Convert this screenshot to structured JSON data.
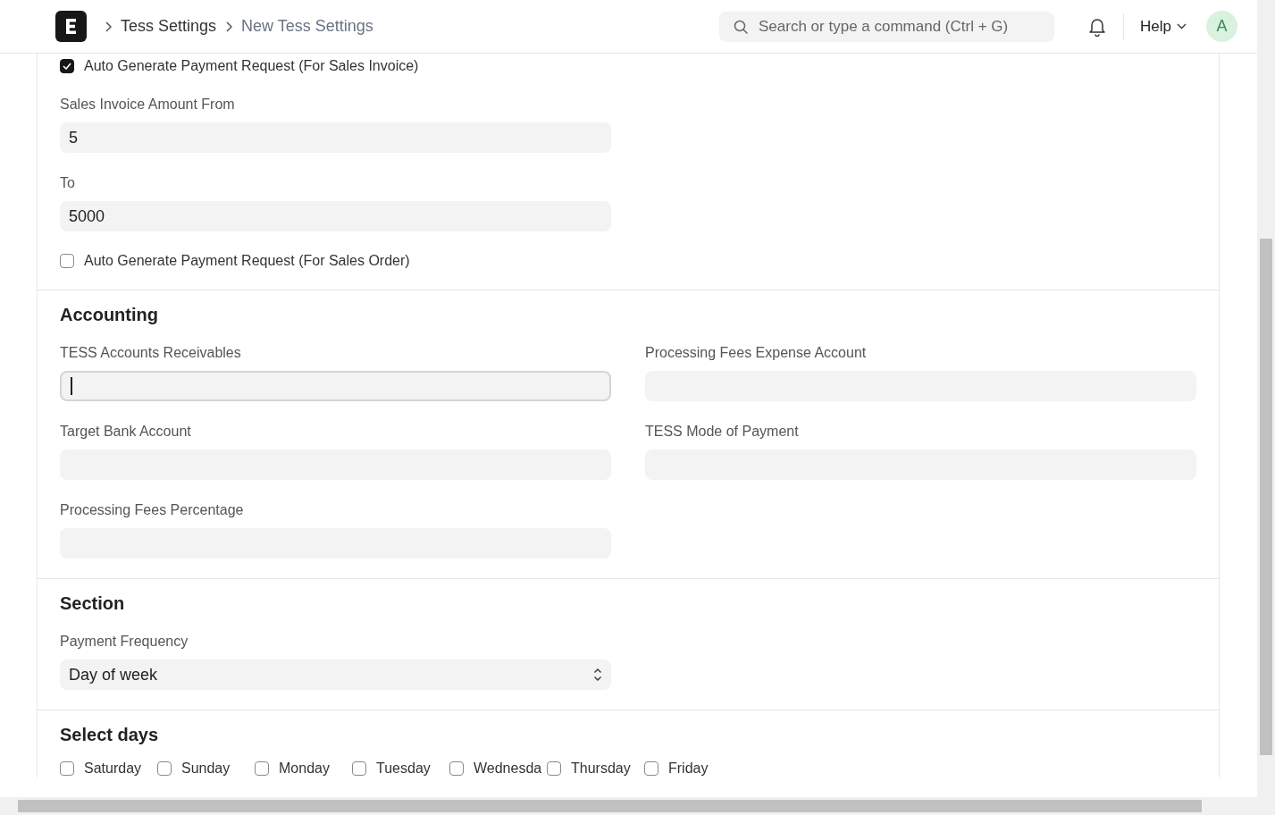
{
  "breadcrumbs": [
    {
      "label": "Tess Settings",
      "current": false
    },
    {
      "label": "New Tess Settings",
      "current": true
    }
  ],
  "search": {
    "placeholder": "Search or type a command (Ctrl + G)"
  },
  "help_menu": {
    "label": "Help"
  },
  "avatar": {
    "initial": "A"
  },
  "sections": [
    {
      "columns": [
        [
          {
            "kind": "checkbox",
            "label": "Auto Generate Payment Request (For Sales Invoice)",
            "checked": true
          },
          {
            "kind": "input",
            "label": "Sales Invoice Amount From",
            "value": "5",
            "focused": false
          },
          {
            "kind": "input",
            "label": "To",
            "value": "5000",
            "focused": false
          },
          {
            "kind": "checkbox",
            "label": "Auto Generate Payment Request (For Sales Order)",
            "checked": false
          }
        ]
      ]
    },
    {
      "heading": "Accounting",
      "columns": [
        [
          {
            "kind": "input",
            "label": "TESS Accounts Receivables",
            "focused": true
          },
          {
            "kind": "input",
            "label": "Target Bank Account",
            "focused": false
          },
          {
            "kind": "input",
            "label": "Processing Fees Percentage",
            "focused": false
          }
        ],
        [
          {
            "kind": "input",
            "label": "Processing Fees Expense Account",
            "focused": false
          },
          {
            "kind": "input",
            "label": "TESS Mode of Payment",
            "focused": false
          }
        ]
      ]
    },
    {
      "heading": "Section",
      "columns": [
        [
          {
            "kind": "select",
            "label": "Payment Frequency",
            "value": "Day of week"
          }
        ]
      ]
    },
    {
      "heading": "Select days",
      "days": [
        {
          "label": "Saturday",
          "checked": false
        },
        {
          "label": "Sunday",
          "checked": false
        },
        {
          "label": "Monday",
          "checked": false
        },
        {
          "label": "Tuesday",
          "checked": false
        },
        {
          "label": "Wednesda",
          "checked": false
        },
        {
          "label": "Thursday",
          "checked": false
        },
        {
          "label": "Friday",
          "checked": false
        }
      ]
    }
  ]
}
